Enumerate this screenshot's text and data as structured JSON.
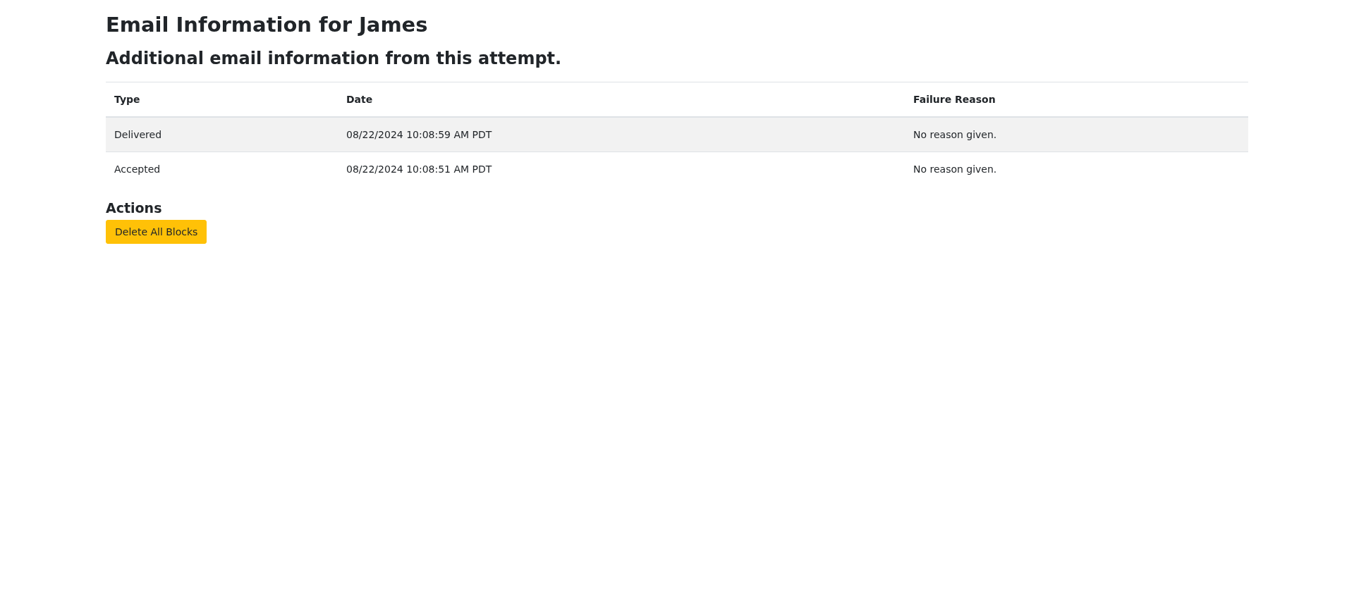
{
  "title": "Email Information for James",
  "subtitle": "Additional email information from this attempt.",
  "table": {
    "columns": [
      "Type",
      "Date",
      "Failure Reason"
    ],
    "rows": [
      [
        "Delivered",
        "08/22/2024 10:08:59 AM PDT",
        "No reason given."
      ],
      [
        "Accepted",
        "08/22/2024 10:08:51 AM PDT",
        "No reason given."
      ]
    ]
  },
  "actions": {
    "heading": "Actions",
    "buttons": [
      "Delete All Blocks"
    ]
  }
}
